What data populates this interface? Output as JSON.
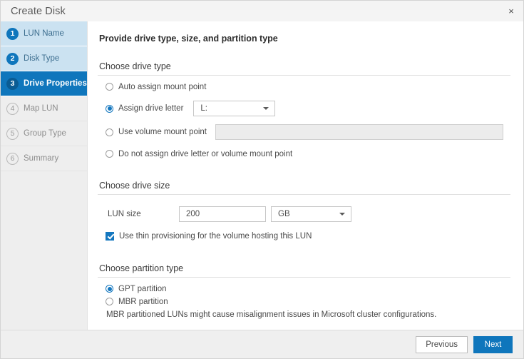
{
  "window": {
    "title": "Create Disk",
    "close_icon": "close-icon",
    "close_glyph": "×"
  },
  "sidebar": {
    "steps": [
      {
        "num": "1",
        "label": "LUN Name",
        "state": "done"
      },
      {
        "num": "2",
        "label": "Disk Type",
        "state": "done"
      },
      {
        "num": "3",
        "label": "Drive Properties",
        "state": "active"
      },
      {
        "num": "4",
        "label": "Map LUN",
        "state": "pending"
      },
      {
        "num": "5",
        "label": "Group Type",
        "state": "pending"
      },
      {
        "num": "6",
        "label": "Summary",
        "state": "pending"
      }
    ]
  },
  "main": {
    "page_title": "Provide drive type, size, and partition type",
    "drive_type": {
      "heading": "Choose drive type",
      "options": [
        {
          "label": "Auto assign mount point",
          "selected": false
        },
        {
          "label": "Assign drive letter",
          "selected": true
        },
        {
          "label": "Use volume mount point",
          "selected": false
        },
        {
          "label": "Do not assign drive letter or volume mount point",
          "selected": false
        }
      ],
      "drive_letter_value": "L:",
      "mount_point_value": "",
      "mount_point_placeholder": ""
    },
    "drive_size": {
      "heading": "Choose drive size",
      "lun_size_label": "LUN size",
      "lun_size_value": "200",
      "unit_value": "GB",
      "thin_provisioning_label": "Use thin provisioning for the volume hosting this LUN",
      "thin_provisioning_checked": true
    },
    "partition_type": {
      "heading": "Choose partition type",
      "options": [
        {
          "label": "GPT partition",
          "selected": true
        },
        {
          "label": "MBR partition",
          "selected": false
        }
      ],
      "note": "MBR partitioned LUNs might cause misalignment issues in Microsoft cluster configurations."
    }
  },
  "footer": {
    "previous_label": "Previous",
    "next_label": "Next"
  },
  "colors": {
    "accent_blue": "#0f76bc",
    "step_done_bg": "#cbe2f1",
    "step_pending_bg": "#eeeeee",
    "titlebar_bg": "#f4f4f4",
    "footer_bg": "#efefef"
  }
}
